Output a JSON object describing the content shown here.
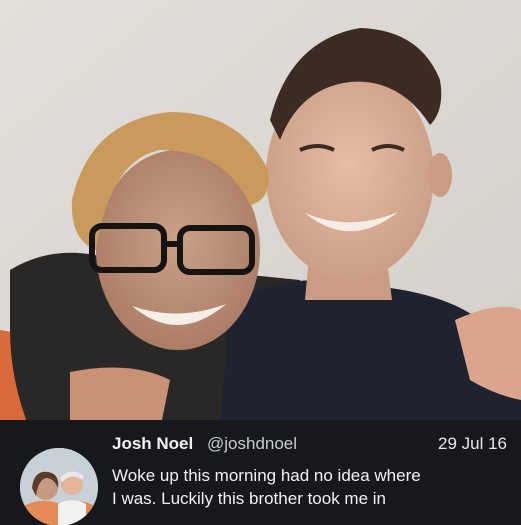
{
  "tweet": {
    "author_name": "Josh Noel",
    "author_handle": "@joshdnoel",
    "date": "29 Jul 16",
    "text_lines": [
      "Woke up this morning had no idea where",
      "I was. Luckily this brother took me in"
    ]
  },
  "photo": {
    "subject": "two-friends-selfie-icon",
    "avatar": "profile-avatar-icon"
  },
  "colors": {
    "tweet_background": "#16181b",
    "name_text": "#f2f2f2",
    "handle_text": "#c9cbce",
    "wall": "#dcd8d3"
  }
}
